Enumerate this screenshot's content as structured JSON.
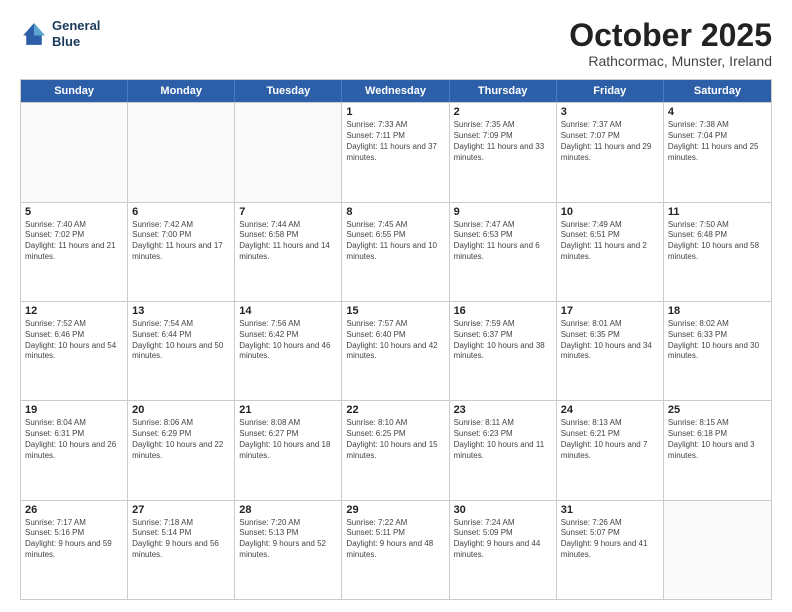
{
  "logo": {
    "line1": "General",
    "line2": "Blue"
  },
  "title": "October 2025",
  "subtitle": "Rathcormac, Munster, Ireland",
  "days": [
    "Sunday",
    "Monday",
    "Tuesday",
    "Wednesday",
    "Thursday",
    "Friday",
    "Saturday"
  ],
  "weeks": [
    [
      {
        "day": "",
        "sunrise": "",
        "sunset": "",
        "daylight": ""
      },
      {
        "day": "",
        "sunrise": "",
        "sunset": "",
        "daylight": ""
      },
      {
        "day": "",
        "sunrise": "",
        "sunset": "",
        "daylight": ""
      },
      {
        "day": "1",
        "sunrise": "Sunrise: 7:33 AM",
        "sunset": "Sunset: 7:11 PM",
        "daylight": "Daylight: 11 hours and 37 minutes."
      },
      {
        "day": "2",
        "sunrise": "Sunrise: 7:35 AM",
        "sunset": "Sunset: 7:09 PM",
        "daylight": "Daylight: 11 hours and 33 minutes."
      },
      {
        "day": "3",
        "sunrise": "Sunrise: 7:37 AM",
        "sunset": "Sunset: 7:07 PM",
        "daylight": "Daylight: 11 hours and 29 minutes."
      },
      {
        "day": "4",
        "sunrise": "Sunrise: 7:38 AM",
        "sunset": "Sunset: 7:04 PM",
        "daylight": "Daylight: 11 hours and 25 minutes."
      }
    ],
    [
      {
        "day": "5",
        "sunrise": "Sunrise: 7:40 AM",
        "sunset": "Sunset: 7:02 PM",
        "daylight": "Daylight: 11 hours and 21 minutes."
      },
      {
        "day": "6",
        "sunrise": "Sunrise: 7:42 AM",
        "sunset": "Sunset: 7:00 PM",
        "daylight": "Daylight: 11 hours and 17 minutes."
      },
      {
        "day": "7",
        "sunrise": "Sunrise: 7:44 AM",
        "sunset": "Sunset: 6:58 PM",
        "daylight": "Daylight: 11 hours and 14 minutes."
      },
      {
        "day": "8",
        "sunrise": "Sunrise: 7:45 AM",
        "sunset": "Sunset: 6:55 PM",
        "daylight": "Daylight: 11 hours and 10 minutes."
      },
      {
        "day": "9",
        "sunrise": "Sunrise: 7:47 AM",
        "sunset": "Sunset: 6:53 PM",
        "daylight": "Daylight: 11 hours and 6 minutes."
      },
      {
        "day": "10",
        "sunrise": "Sunrise: 7:49 AM",
        "sunset": "Sunset: 6:51 PM",
        "daylight": "Daylight: 11 hours and 2 minutes."
      },
      {
        "day": "11",
        "sunrise": "Sunrise: 7:50 AM",
        "sunset": "Sunset: 6:48 PM",
        "daylight": "Daylight: 10 hours and 58 minutes."
      }
    ],
    [
      {
        "day": "12",
        "sunrise": "Sunrise: 7:52 AM",
        "sunset": "Sunset: 6:46 PM",
        "daylight": "Daylight: 10 hours and 54 minutes."
      },
      {
        "day": "13",
        "sunrise": "Sunrise: 7:54 AM",
        "sunset": "Sunset: 6:44 PM",
        "daylight": "Daylight: 10 hours and 50 minutes."
      },
      {
        "day": "14",
        "sunrise": "Sunrise: 7:56 AM",
        "sunset": "Sunset: 6:42 PM",
        "daylight": "Daylight: 10 hours and 46 minutes."
      },
      {
        "day": "15",
        "sunrise": "Sunrise: 7:57 AM",
        "sunset": "Sunset: 6:40 PM",
        "daylight": "Daylight: 10 hours and 42 minutes."
      },
      {
        "day": "16",
        "sunrise": "Sunrise: 7:59 AM",
        "sunset": "Sunset: 6:37 PM",
        "daylight": "Daylight: 10 hours and 38 minutes."
      },
      {
        "day": "17",
        "sunrise": "Sunrise: 8:01 AM",
        "sunset": "Sunset: 6:35 PM",
        "daylight": "Daylight: 10 hours and 34 minutes."
      },
      {
        "day": "18",
        "sunrise": "Sunrise: 8:02 AM",
        "sunset": "Sunset: 6:33 PM",
        "daylight": "Daylight: 10 hours and 30 minutes."
      }
    ],
    [
      {
        "day": "19",
        "sunrise": "Sunrise: 8:04 AM",
        "sunset": "Sunset: 6:31 PM",
        "daylight": "Daylight: 10 hours and 26 minutes."
      },
      {
        "day": "20",
        "sunrise": "Sunrise: 8:06 AM",
        "sunset": "Sunset: 6:29 PM",
        "daylight": "Daylight: 10 hours and 22 minutes."
      },
      {
        "day": "21",
        "sunrise": "Sunrise: 8:08 AM",
        "sunset": "Sunset: 6:27 PM",
        "daylight": "Daylight: 10 hours and 18 minutes."
      },
      {
        "day": "22",
        "sunrise": "Sunrise: 8:10 AM",
        "sunset": "Sunset: 6:25 PM",
        "daylight": "Daylight: 10 hours and 15 minutes."
      },
      {
        "day": "23",
        "sunrise": "Sunrise: 8:11 AM",
        "sunset": "Sunset: 6:23 PM",
        "daylight": "Daylight: 10 hours and 11 minutes."
      },
      {
        "day": "24",
        "sunrise": "Sunrise: 8:13 AM",
        "sunset": "Sunset: 6:21 PM",
        "daylight": "Daylight: 10 hours and 7 minutes."
      },
      {
        "day": "25",
        "sunrise": "Sunrise: 8:15 AM",
        "sunset": "Sunset: 6:18 PM",
        "daylight": "Daylight: 10 hours and 3 minutes."
      }
    ],
    [
      {
        "day": "26",
        "sunrise": "Sunrise: 7:17 AM",
        "sunset": "Sunset: 5:16 PM",
        "daylight": "Daylight: 9 hours and 59 minutes."
      },
      {
        "day": "27",
        "sunrise": "Sunrise: 7:18 AM",
        "sunset": "Sunset: 5:14 PM",
        "daylight": "Daylight: 9 hours and 56 minutes."
      },
      {
        "day": "28",
        "sunrise": "Sunrise: 7:20 AM",
        "sunset": "Sunset: 5:13 PM",
        "daylight": "Daylight: 9 hours and 52 minutes."
      },
      {
        "day": "29",
        "sunrise": "Sunrise: 7:22 AM",
        "sunset": "Sunset: 5:11 PM",
        "daylight": "Daylight: 9 hours and 48 minutes."
      },
      {
        "day": "30",
        "sunrise": "Sunrise: 7:24 AM",
        "sunset": "Sunset: 5:09 PM",
        "daylight": "Daylight: 9 hours and 44 minutes."
      },
      {
        "day": "31",
        "sunrise": "Sunrise: 7:26 AM",
        "sunset": "Sunset: 5:07 PM",
        "daylight": "Daylight: 9 hours and 41 minutes."
      },
      {
        "day": "",
        "sunrise": "",
        "sunset": "",
        "daylight": ""
      }
    ]
  ]
}
